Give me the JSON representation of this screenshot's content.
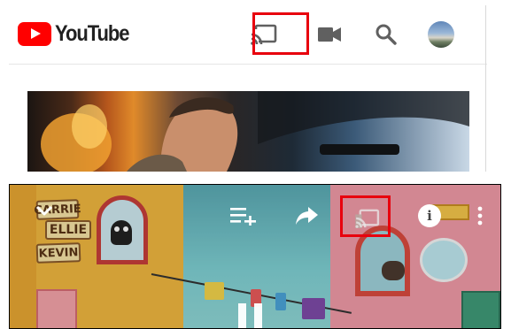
{
  "top": {
    "logo_text": "YouTube",
    "icons": {
      "logo": "youtube-play-icon",
      "cast": "cast-icon",
      "camera": "video-camera-icon",
      "search": "search-icon",
      "avatar": "account-avatar"
    },
    "highlight_color": "#e8000d",
    "brand_color": "#ff0000"
  },
  "player": {
    "signs": [
      "CARRIE",
      "ELLIE",
      "KEVIN"
    ],
    "icons": {
      "collapse": "chevron-down-icon",
      "add_to_queue": "playlist-add-icon",
      "share": "share-arrow-icon",
      "cast": "cast-icon",
      "info": "info-icon",
      "more": "more-vertical-icon",
      "pause": "pause-icon"
    },
    "info_glyph": "i"
  }
}
